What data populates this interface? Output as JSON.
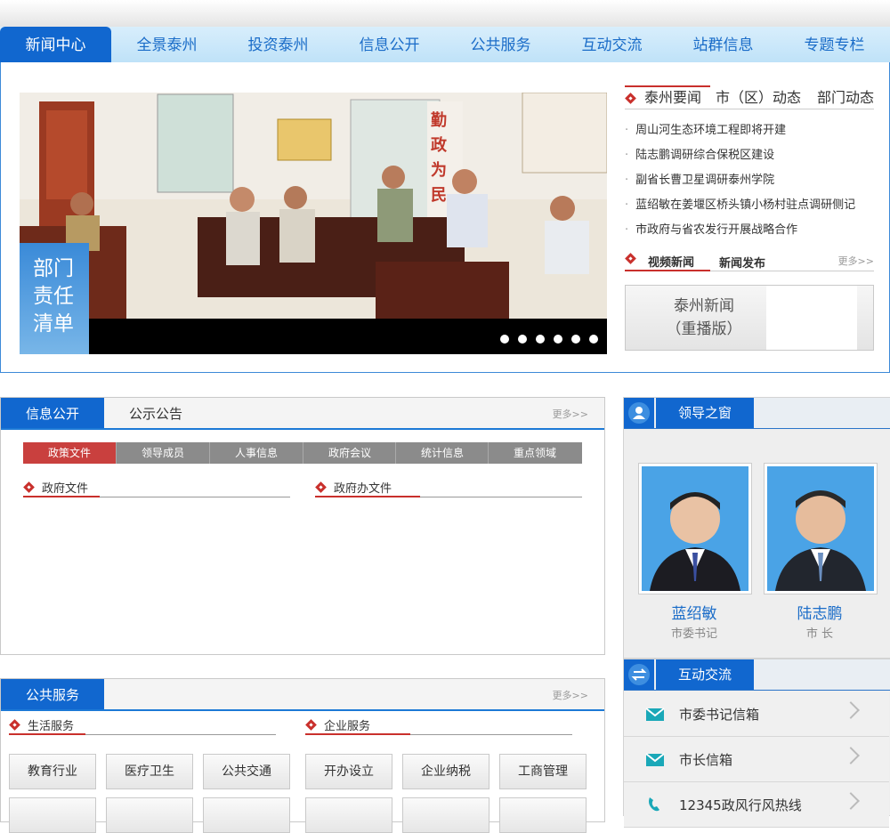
{
  "nav": {
    "tabs": [
      "新闻中心",
      "全景泰州",
      "投资泰州",
      "信息公开",
      "公共服务",
      "互动交流",
      "站群信息",
      "专题专栏"
    ]
  },
  "slider": {
    "badge": [
      "部门",
      "责任",
      "清单"
    ],
    "slogan": "勤政为民",
    "dots": 6
  },
  "news": {
    "tabs": [
      "泰州要闻",
      "市（区）动态",
      "部门动态"
    ],
    "items": [
      "周山河生态环境工程即将开建",
      "陆志鹏调研综合保税区建设",
      "副省长曹卫星调研泰州学院",
      "蓝绍敏在姜堰区桥头镇小杨村驻点调研侧记",
      "市政府与省农发行开展战略合作"
    ]
  },
  "video": {
    "tabs": [
      "视频新闻",
      "新闻发布"
    ],
    "more": "更多>>",
    "card_title": "泰州新闻",
    "card_sub": "（重播版）"
  },
  "info": {
    "tabs": [
      "信息公开",
      "公示公告"
    ],
    "more": "更多>>",
    "subtabs": [
      "政策文件",
      "领导成员",
      "人事信息",
      "政府会议",
      "统计信息",
      "重点领域"
    ],
    "sections": [
      "政府文件",
      "政府办文件"
    ]
  },
  "leaders": {
    "title": "领导之窗",
    "people": [
      {
        "name": "蓝绍敏",
        "role": "市委书记"
      },
      {
        "name": "陆志鹏",
        "role": "市 长"
      }
    ]
  },
  "interact": {
    "title": "互动交流",
    "items": [
      "市委书记信箱",
      "市长信箱",
      "12345政风行风热线"
    ]
  },
  "service": {
    "title": "公共服务",
    "more": "更多>>",
    "life": {
      "title": "生活服务",
      "buttons": [
        "教育行业",
        "医疗卫生",
        "公共交通"
      ]
    },
    "biz": {
      "title": "企业服务",
      "buttons": [
        "开办设立",
        "企业纳税",
        "工商管理"
      ]
    }
  }
}
